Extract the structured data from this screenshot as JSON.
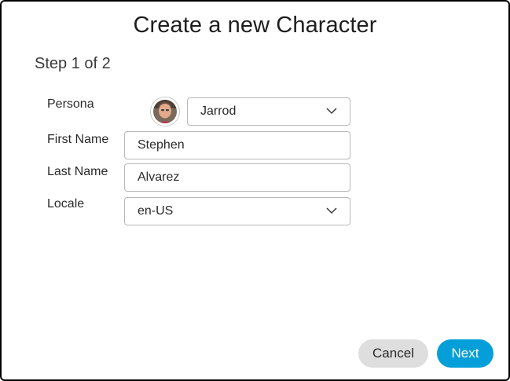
{
  "dialog": {
    "title": "Create a new Character",
    "step": "Step 1 of 2"
  },
  "form": {
    "persona": {
      "label": "Persona",
      "value": "Jarrod",
      "avatar_icon": "user-avatar"
    },
    "first_name": {
      "label": "First Name",
      "value": "Stephen"
    },
    "last_name": {
      "label": "Last Name",
      "value": "Alvarez"
    },
    "locale": {
      "label": "Locale",
      "value": "en-US"
    }
  },
  "actions": {
    "cancel_label": "Cancel",
    "next_label": "Next"
  },
  "colors": {
    "accent": "#049fd9",
    "secondary_button": "#dedede"
  }
}
